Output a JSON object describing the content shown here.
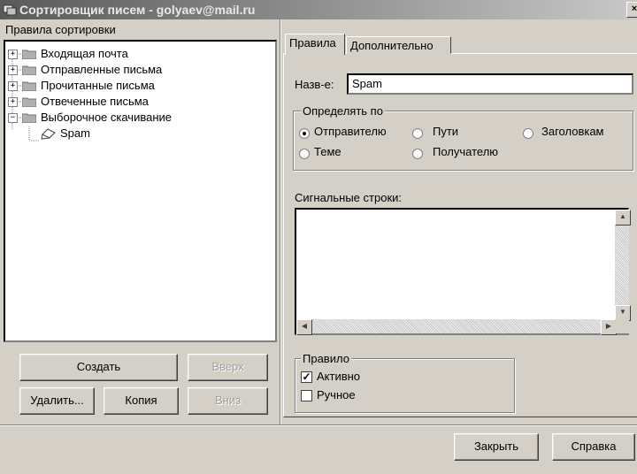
{
  "window": {
    "title": "Сортировщик писем - golyaev@mail.ru",
    "close_symbol": "×"
  },
  "left_panel": {
    "label": "Правила сортировки",
    "tree": [
      {
        "label": "Входящая почта",
        "expander": "+",
        "icon": "folder-icon"
      },
      {
        "label": "Отправленные письма",
        "expander": "+",
        "icon": "folder-icon"
      },
      {
        "label": "Прочитанные письма",
        "expander": "+",
        "icon": "folder-icon"
      },
      {
        "label": "Отвеченные письма",
        "expander": "+",
        "icon": "folder-icon"
      },
      {
        "label": "Выборочное скачивание",
        "expander": "−",
        "icon": "folder-icon"
      },
      {
        "label": "Spam",
        "icon": "rule-icon"
      }
    ],
    "buttons": {
      "create": "Создать",
      "up": "Вверх",
      "delete": "Удалить...",
      "copy": "Копия",
      "down": "Вниз"
    }
  },
  "tabs": {
    "rules": "Правила",
    "advanced": "Дополнительно"
  },
  "rule_form": {
    "name_label": "Назв-е:",
    "name_value": "Spam",
    "define_by": {
      "legend": "Определять по",
      "options": {
        "sender": "Отправителю",
        "path": "Пути",
        "headers": "Заголовкам",
        "subject": "Теме",
        "recipient": "Получателю"
      },
      "selected": "sender"
    },
    "signal_label": "Сигнальные строки:",
    "signal_value": "",
    "rule_group": {
      "legend": "Правило",
      "active_label": "Активно",
      "active_checked": true,
      "manual_label": "Ручное",
      "manual_checked": false
    }
  },
  "footer": {
    "close": "Закрыть",
    "help": "Справка"
  },
  "colors": {
    "face": "#d4d0c8",
    "shadow": "#808080",
    "field": "#ffffff"
  }
}
